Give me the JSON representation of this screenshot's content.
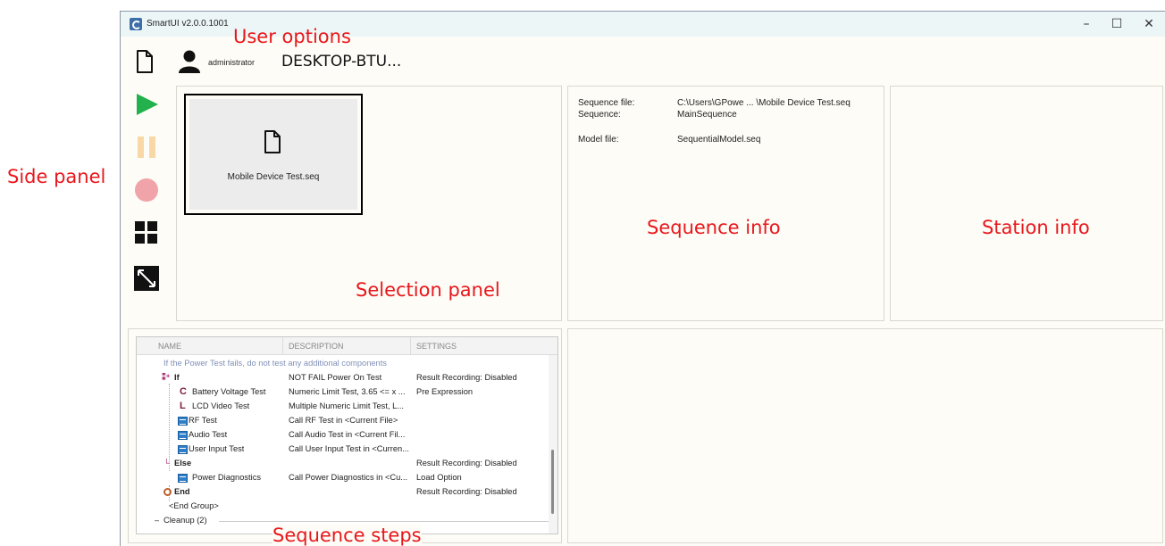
{
  "window": {
    "title": "SmartUI v2.0.0.1001",
    "controls": {
      "minimize": "–",
      "maximize": "☐",
      "close": "✕"
    }
  },
  "toolbar": {
    "username": "administrator",
    "station_name": "DESKTOP-BTU..."
  },
  "side_panel": {
    "buttons": [
      {
        "name": "run",
        "icon": "play-icon",
        "color": "#22b14c"
      },
      {
        "name": "pause",
        "icon": "pause-icon",
        "color": "#f9d8a8"
      },
      {
        "name": "stop",
        "icon": "record-stop-icon",
        "color": "#f0a3a8"
      },
      {
        "name": "layout",
        "icon": "grid-icon",
        "color": "#111111"
      },
      {
        "name": "resize",
        "icon": "resize-icon",
        "color": "#111111"
      }
    ]
  },
  "selection_panel": {
    "sequence_card_label": "Mobile Device Test.seq"
  },
  "sequence_info": {
    "rows": [
      {
        "label": "Sequence file:",
        "value": "C:\\Users\\GPowe ... \\Mobile Device Test.seq"
      },
      {
        "label": "Sequence:",
        "value": "MainSequence"
      },
      {
        "label": "Model file:",
        "value": "SequentialModel.seq"
      }
    ]
  },
  "sequence_steps": {
    "columns": [
      "NAME",
      "DESCRIPTION",
      "SETTINGS"
    ],
    "comment": "If the Power Test fails, do not test any additional components",
    "rows": [
      {
        "icon": "if-icon",
        "name": "If",
        "description": "NOT FAIL Power On Test",
        "settings": "Result Recording: Disabled"
      },
      {
        "icon": "numeric-limit-icon",
        "name": "Battery Voltage Test",
        "description": "Numeric Limit Test,  3.65 <= x ...",
        "settings": "Pre Expression"
      },
      {
        "icon": "multi-limit-icon",
        "name": "LCD Video Test",
        "description": "Multiple Numeric Limit Test,  L...",
        "settings": ""
      },
      {
        "icon": "sequence-call-icon",
        "name": "RF Test",
        "description": "Call RF Test in <Current File>",
        "settings": ""
      },
      {
        "icon": "sequence-call-icon",
        "name": "Audio Test",
        "description": "Call Audio Test in <Current Fil...",
        "settings": ""
      },
      {
        "icon": "sequence-call-icon",
        "name": "User Input Test",
        "description": "Call User Input Test in <Curren...",
        "settings": ""
      },
      {
        "icon": "else-icon",
        "name": "Else",
        "description": "",
        "settings": "Result Recording: Disabled"
      },
      {
        "icon": "sequence-call-icon",
        "name": "Power Diagnostics",
        "description": "Call Power Diagnostics in <Cu...",
        "settings": "Load Option"
      },
      {
        "icon": "end-icon",
        "name": "End",
        "description": "",
        "settings": "Result Recording: Disabled"
      },
      {
        "icon": "",
        "name": "<End Group>",
        "description": "",
        "settings": ""
      }
    ],
    "cleanup": "Cleanup (2)"
  },
  "annotations": {
    "user_options": "User options",
    "side_panel": "Side panel",
    "selection_panel": "Selection panel",
    "sequence_info": "Sequence info",
    "station_info": "Station info",
    "sequence_steps": "Sequence steps"
  }
}
